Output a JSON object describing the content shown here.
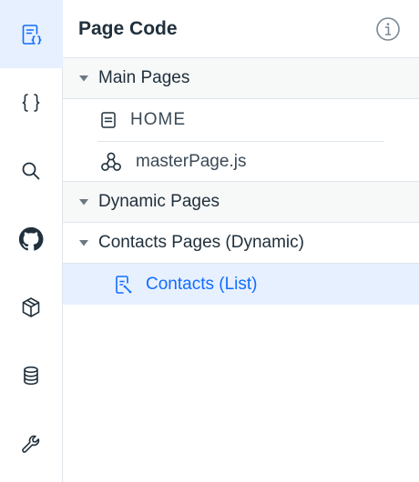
{
  "panel": {
    "title": "Page Code"
  },
  "rail": {
    "items": [
      {
        "icon": "page-code-icon",
        "active": true
      },
      {
        "icon": "curly-braces-icon",
        "active": false
      },
      {
        "icon": "search-icon",
        "active": false
      },
      {
        "icon": "github-icon",
        "active": false
      },
      {
        "icon": "package-icon",
        "active": false
      },
      {
        "icon": "database-icon",
        "active": false
      },
      {
        "icon": "wrench-icon",
        "active": false
      }
    ]
  },
  "tree": {
    "main_pages": {
      "label": "Main Pages",
      "pages": [
        {
          "label": "HOME",
          "icon": "page-icon"
        }
      ],
      "master": {
        "label": "masterPage.js",
        "icon": "master-page-icon"
      }
    },
    "dynamic_pages": {
      "label": "Dynamic Pages",
      "groups": [
        {
          "label": "Contacts Pages (Dynamic)",
          "pages": [
            {
              "label": "Contacts (List)",
              "icon": "dynamic-page-icon",
              "selected": true
            }
          ]
        }
      ]
    }
  },
  "colors": {
    "accent": "#116dff",
    "selected_bg": "#e7f0ff",
    "text": "#20303c",
    "border": "#dfe5eb"
  }
}
